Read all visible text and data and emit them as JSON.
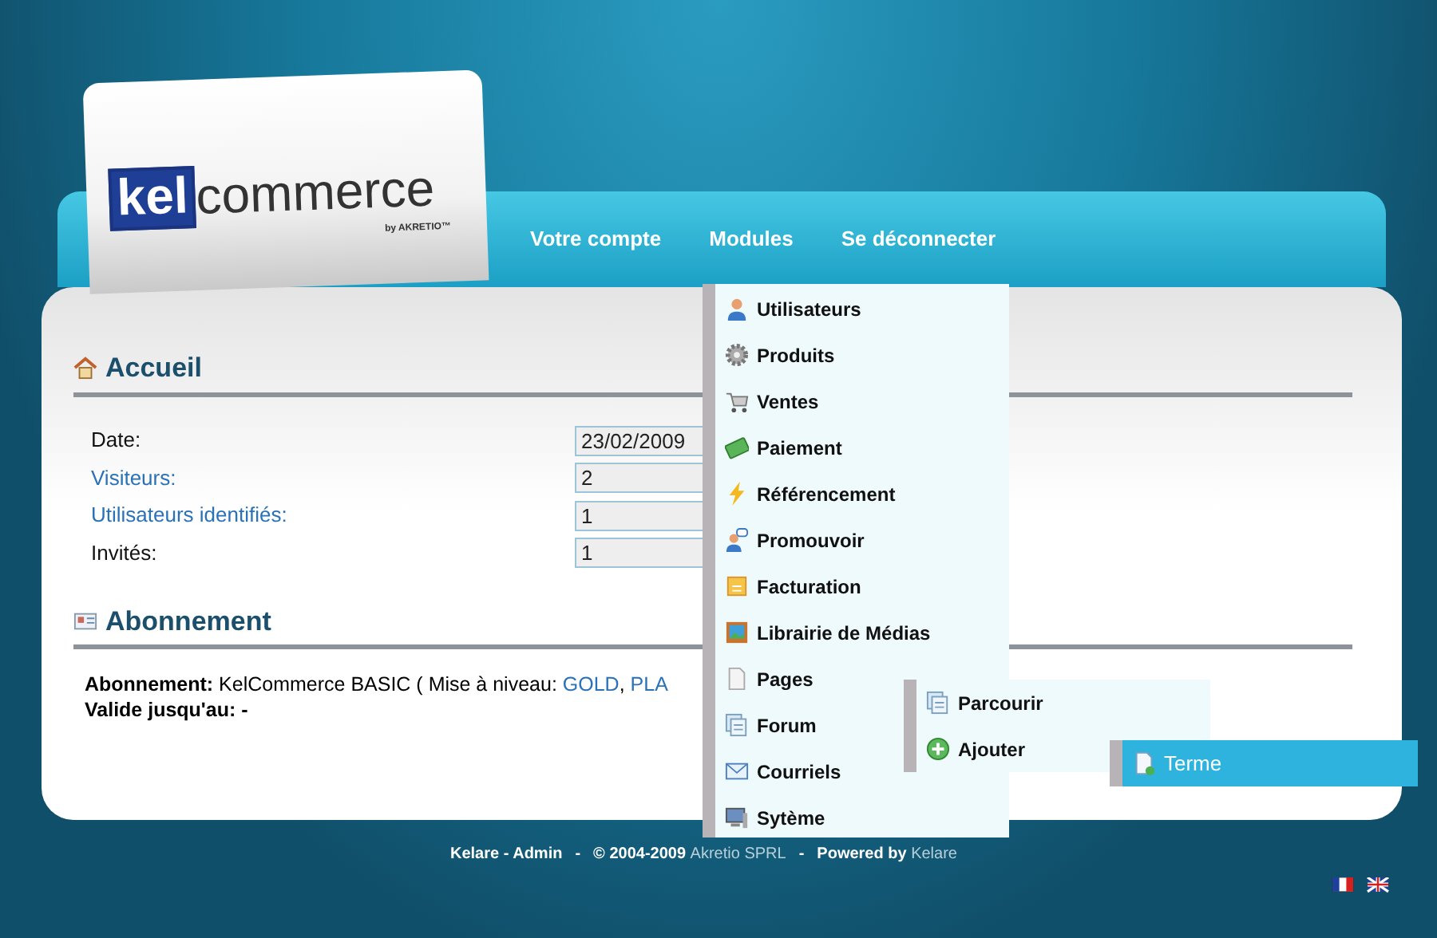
{
  "logo": {
    "mark": "kel",
    "name": "commerce",
    "tagline": "by AKRETIO™"
  },
  "nav": [
    {
      "label": "Votre compte"
    },
    {
      "label": "Modules"
    },
    {
      "label": "Se déconnecter"
    }
  ],
  "accueil": {
    "title": "Accueil",
    "fields": [
      {
        "label": "Date:",
        "value": "23/02/2009",
        "link": false
      },
      {
        "label": "Visiteurs:",
        "value": "2",
        "link": true
      },
      {
        "label": "Utilisateurs identifiés:",
        "value": "1",
        "link": true
      },
      {
        "label": "Invités:",
        "value": "1",
        "link": false
      }
    ]
  },
  "abonnement": {
    "title": "Abonnement",
    "label": "Abonnement:",
    "text": "KelCommerce BASIC ( Mise à niveau:",
    "upgrades": [
      "GOLD",
      "PLA"
    ],
    "upgrade_separator": ", ",
    "valid_label": "Valide jusqu'au:",
    "valid_value": "-"
  },
  "menu": [
    {
      "label": "Utilisateurs"
    },
    {
      "label": "Produits"
    },
    {
      "label": "Ventes"
    },
    {
      "label": "Paiement"
    },
    {
      "label": "Référencement"
    },
    {
      "label": "Promouvoir"
    },
    {
      "label": "Facturation"
    },
    {
      "label": "Librairie de Médias"
    },
    {
      "label": "Pages",
      "children": [
        {
          "label": "Parcourir"
        },
        {
          "label": "Ajouter",
          "children": [
            {
              "label": "Terme",
              "selected": true
            }
          ]
        }
      ]
    },
    {
      "label": "Forum"
    },
    {
      "label": "Courriels"
    },
    {
      "label": "Sytème"
    }
  ],
  "footer": {
    "site": "Kelare - Admin",
    "sep1": "-",
    "copyright": "© 2004-2009",
    "company": "Akretio SPRL",
    "sep2": "-",
    "powered": "Powered by",
    "powered_link": "Kelare"
  }
}
